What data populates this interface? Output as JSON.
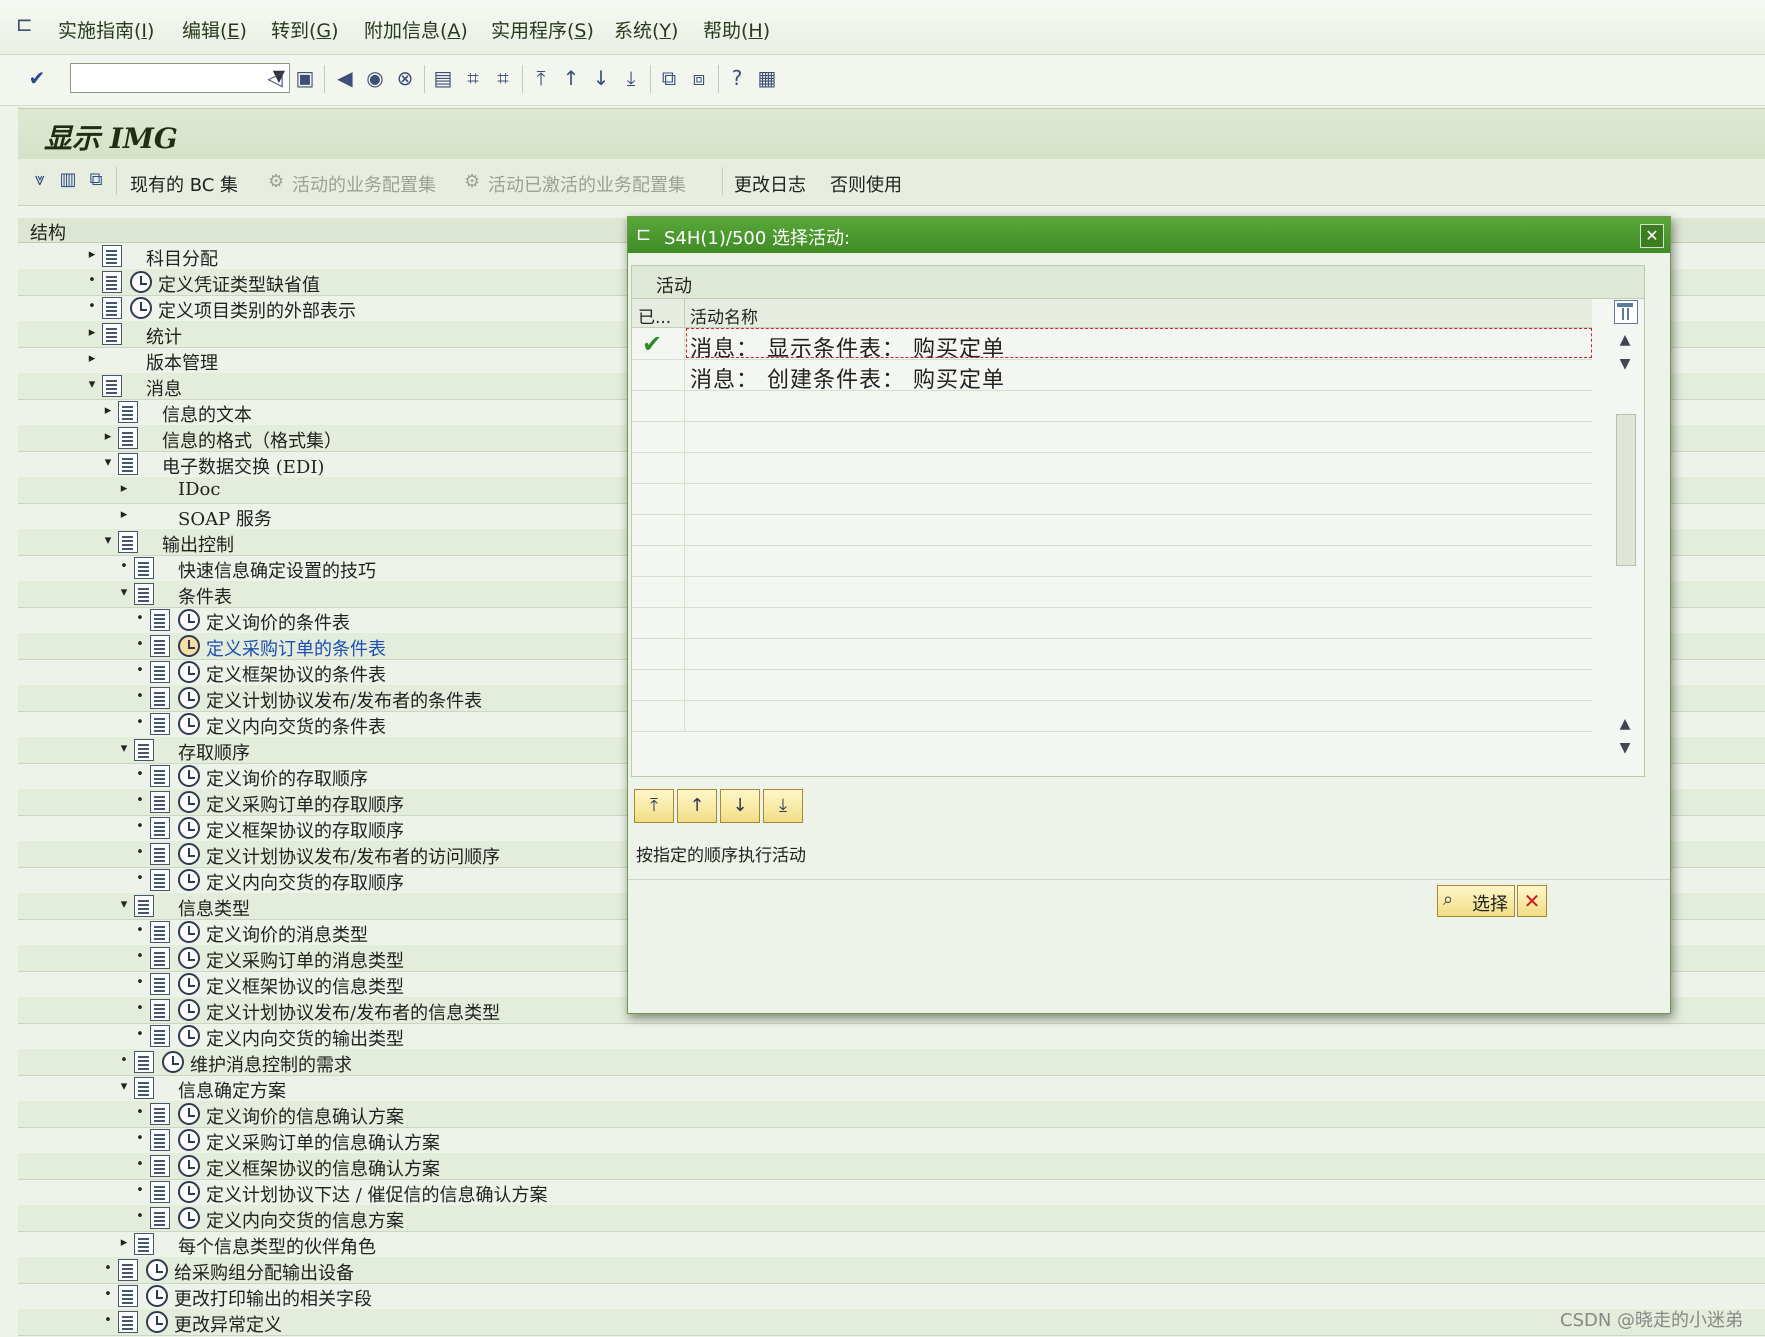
{
  "menu": [
    {
      "label": "实施指南(",
      "key": "I",
      "tail": ")"
    },
    {
      "label": "编辑(",
      "key": "E",
      "tail": ")"
    },
    {
      "label": "转到(",
      "key": "G",
      "tail": ")"
    },
    {
      "label": "附加信息(",
      "key": "A",
      "tail": ")"
    },
    {
      "label": "实用程序(",
      "key": "S",
      "tail": ")"
    },
    {
      "label": "系统(",
      "key": "Y",
      "tail": ")"
    },
    {
      "label": "帮助(",
      "key": "H",
      "tail": ")"
    }
  ],
  "title": "显示 IMG",
  "app_toolbar": {
    "bc_sets": "现有的 BC 集",
    "active_bc_sets": "活动的业务配置集",
    "activated_bc_sets": "活动已激活的业务配置集",
    "change_log": "更改日志",
    "conditional_use": "否则使用"
  },
  "tree": {
    "header": "结构",
    "rows": [
      {
        "label": "科目分配",
        "indent": 0,
        "toggle": "▸",
        "clock": false
      },
      {
        "label": "定义凭证类型缺省值",
        "indent": 0,
        "toggle": "•",
        "clock": true
      },
      {
        "label": "定义项目类别的外部表示",
        "indent": 0,
        "toggle": "•",
        "clock": true
      },
      {
        "label": "统计",
        "indent": 0,
        "toggle": "▸",
        "clock": false
      },
      {
        "label": "版本管理",
        "indent": 0,
        "toggle": "▸",
        "clock": false,
        "nodoc": true
      },
      {
        "label": "消息",
        "indent": 0,
        "toggle": "▾",
        "clock": false
      },
      {
        "label": "信息的文本",
        "indent": 1,
        "toggle": "▸",
        "clock": false
      },
      {
        "label": "信息的格式（格式集）",
        "indent": 1,
        "toggle": "▸",
        "clock": false
      },
      {
        "label": "电子数据交换 (EDI)",
        "indent": 1,
        "toggle": "▾",
        "clock": false
      },
      {
        "label": "IDoc",
        "indent": 2,
        "toggle": "▸",
        "clock": false,
        "nodoc": true
      },
      {
        "label": "SOAP 服务",
        "indent": 2,
        "toggle": "▸",
        "clock": false,
        "nodoc": true
      },
      {
        "label": "输出控制",
        "indent": 1,
        "toggle": "▾",
        "clock": false
      },
      {
        "label": "快速信息确定设置的技巧",
        "indent": 2,
        "toggle": "•",
        "clock": false
      },
      {
        "label": "条件表",
        "indent": 2,
        "toggle": "▾",
        "clock": false
      },
      {
        "label": "定义询价的条件表",
        "indent": 3,
        "toggle": "•",
        "clock": true
      },
      {
        "label": "定义采购订单的条件表",
        "indent": 3,
        "toggle": "•",
        "clock": true,
        "selected": true
      },
      {
        "label": "定义框架协议的条件表",
        "indent": 3,
        "toggle": "•",
        "clock": true
      },
      {
        "label": "定义计划协议发布/发布者的条件表",
        "indent": 3,
        "toggle": "•",
        "clock": true
      },
      {
        "label": "定义内向交货的条件表",
        "indent": 3,
        "toggle": "•",
        "clock": true
      },
      {
        "label": "存取顺序",
        "indent": 2,
        "toggle": "▾",
        "clock": false
      },
      {
        "label": "定义询价的存取顺序",
        "indent": 3,
        "toggle": "•",
        "clock": true
      },
      {
        "label": "定义采购订单的存取顺序",
        "indent": 3,
        "toggle": "•",
        "clock": true
      },
      {
        "label": "定义框架协议的存取顺序",
        "indent": 3,
        "toggle": "•",
        "clock": true
      },
      {
        "label": "定义计划协议发布/发布者的访问顺序",
        "indent": 3,
        "toggle": "•",
        "clock": true
      },
      {
        "label": "定义内向交货的存取顺序",
        "indent": 3,
        "toggle": "•",
        "clock": true
      },
      {
        "label": "信息类型",
        "indent": 2,
        "toggle": "▾",
        "clock": false
      },
      {
        "label": "定义询价的消息类型",
        "indent": 3,
        "toggle": "•",
        "clock": true
      },
      {
        "label": "定义采购订单的消息类型",
        "indent": 3,
        "toggle": "•",
        "clock": true
      },
      {
        "label": "定义框架协议的信息类型",
        "indent": 3,
        "toggle": "•",
        "clock": true
      },
      {
        "label": "定义计划协议发布/发布者的信息类型",
        "indent": 3,
        "toggle": "•",
        "clock": true
      },
      {
        "label": "定义内向交货的输出类型",
        "indent": 3,
        "toggle": "•",
        "clock": true
      },
      {
        "label": "维护消息控制的需求",
        "indent": 2,
        "toggle": "•",
        "clock": true
      },
      {
        "label": "信息确定方案",
        "indent": 2,
        "toggle": "▾",
        "clock": false
      },
      {
        "label": "定义询价的信息确认方案",
        "indent": 3,
        "toggle": "•",
        "clock": true
      },
      {
        "label": "定义采购订单的信息确认方案",
        "indent": 3,
        "toggle": "•",
        "clock": true
      },
      {
        "label": "定义框架协议的信息确认方案",
        "indent": 3,
        "toggle": "•",
        "clock": true
      },
      {
        "label": "定义计划协议下达 / 催促信的信息确认方案",
        "indent": 3,
        "toggle": "•",
        "clock": true
      },
      {
        "label": "定义内向交货的信息方案",
        "indent": 3,
        "toggle": "•",
        "clock": true
      },
      {
        "label": "每个信息类型的伙伴角色",
        "indent": 2,
        "toggle": "▸",
        "clock": false
      },
      {
        "label": "给采购组分配输出设备",
        "indent": 1,
        "toggle": "•",
        "clock": true
      },
      {
        "label": "更改打印输出的相关字段",
        "indent": 1,
        "toggle": "•",
        "clock": true
      },
      {
        "label": "更改异常定义",
        "indent": 1,
        "toggle": "•",
        "clock": true
      }
    ]
  },
  "dialog": {
    "title": "S4H(1)/500 选择活动:",
    "table_title": "活动",
    "col_done": "已...",
    "col_name": "活动名称",
    "rows": [
      {
        "done": "✔",
        "name": "消息：  显示条件表：  购买定单"
      },
      {
        "done": "",
        "name": "消息：  创建条件表：  购买定单"
      }
    ],
    "empty_rows": 11,
    "hint": "按指定的顺序执行活动",
    "select_label": "选择"
  },
  "watermark": "CSDN @晓走的小迷弟"
}
